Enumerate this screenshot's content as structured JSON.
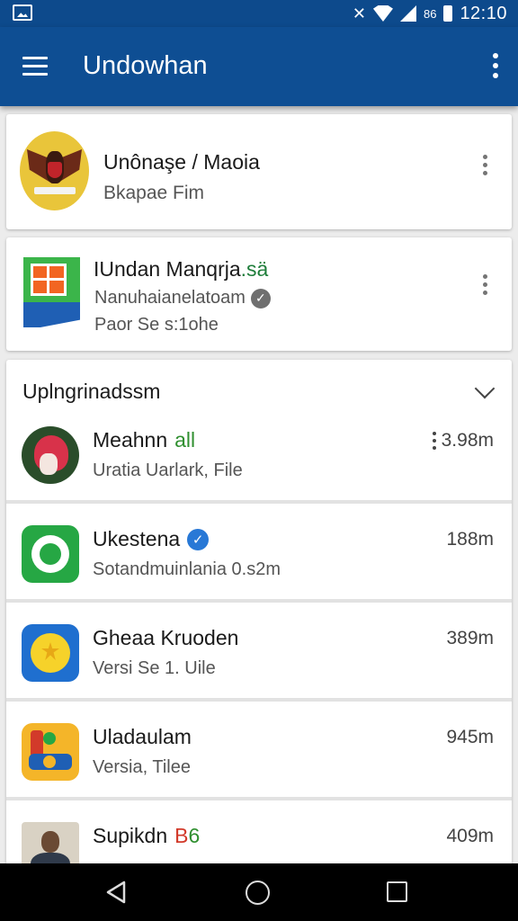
{
  "status_bar": {
    "icons": [
      "image-icon",
      "mute-icon",
      "wifi-icon",
      "signal-icon",
      "battery-icon"
    ],
    "pct": "86",
    "time": "12:10"
  },
  "app_bar": {
    "title": "Undowhan",
    "color": "#0e4e93"
  },
  "cards": [
    {
      "icon": "emblem-icon",
      "title": "Unônaşe / Maoia",
      "subtitle": "Bkapaе Fim"
    },
    {
      "icon": "window-app-icon",
      "title": "IUndan Manqrja",
      "title_accent": ".sä",
      "subtitle1": "Nanuhaianelatoam",
      "subtitle2": "Paor Se s:1ohe"
    }
  ],
  "updates": {
    "title": "Uplngrinadssm",
    "items": [
      {
        "icon": "parrot-icon",
        "title": "Meahnn",
        "title_accent": "all",
        "subtitle": "Uratia Uarlark, File",
        "size": "3.98m"
      },
      {
        "icon": "ring-icon",
        "title": "Ukestena",
        "verified": true,
        "subtitle": "Sotandmuinlania 0.s2m",
        "size": "188m"
      },
      {
        "icon": "sun-icon",
        "title": "Gheaa Kruoden",
        "subtitle": "Versi Se 1. Uile",
        "size": "389m"
      },
      {
        "icon": "toy-icon",
        "title": "Uladaulam",
        "subtitle": "Versia, Tilee",
        "size": "945m"
      },
      {
        "icon": "person-icon",
        "title": "Supikdn",
        "title_accent_red": "B",
        "title_accent_green": "6",
        "subtitle": "",
        "size": "409m"
      }
    ]
  },
  "nav_bar": {
    "icons": [
      "back-icon",
      "home-icon",
      "recents-icon"
    ]
  }
}
